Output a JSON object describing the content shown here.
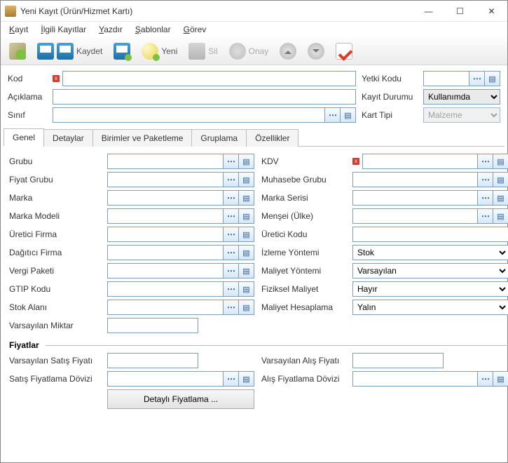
{
  "window": {
    "title": "Yeni Kayıt (Ürün/Hizmet Kartı)"
  },
  "menu": {
    "kayit": "Kayıt",
    "ilgili": "İlgili Kayıtlar",
    "yazdir": "Yazdır",
    "sablonlar": "Şablonlar",
    "gorev": "Görev"
  },
  "toolbar": {
    "kaydet": "Kaydet",
    "yeni": "Yeni",
    "sil": "Sil",
    "onay": "Onay"
  },
  "header": {
    "kod_label": "Kod",
    "kod_value": "",
    "aciklama_label": "Açıklama",
    "aciklama_value": "",
    "sinif_label": "Sınıf",
    "sinif_value": "",
    "yetki_label": "Yetki Kodu",
    "yetki_value": "",
    "durum_label": "Kayıt Durumu",
    "durum_value": "Kullanımda",
    "tipi_label": "Kart Tipi",
    "tipi_value": "Malzeme"
  },
  "tabs": {
    "genel": "Genel",
    "detaylar": "Detaylar",
    "birimler": "Birimler ve Paketleme",
    "gruplama": "Gruplama",
    "ozellikler": "Özellikler"
  },
  "fields": {
    "grubu": "Grubu",
    "grubu_v": "",
    "fiyat_grubu": "Fiyat Grubu",
    "fiyat_grubu_v": "",
    "marka": "Marka",
    "marka_v": "",
    "marka_modeli": "Marka Modeli",
    "marka_modeli_v": "",
    "uretici_firma": "Üretici Firma",
    "uretici_firma_v": "",
    "dagitici_firma": "Dağıtıcı Firma",
    "dagitici_firma_v": "",
    "vergi_paketi": "Vergi Paketi",
    "vergi_paketi_v": "",
    "gtip": "GTIP Kodu",
    "gtip_v": "",
    "stok_alani": "Stok Alanı",
    "stok_alani_v": "",
    "varsayilan_miktar": "Varsayılan Miktar",
    "varsayilan_miktar_v": "",
    "kdv": "KDV",
    "kdv_v": "",
    "muh_grubu": "Muhasebe Grubu",
    "muh_grubu_v": "",
    "marka_serisi": "Marka Serisi",
    "marka_serisi_v": "",
    "mensei": "Menşei (Ülke)",
    "mensei_v": "",
    "uretici_kodu": "Üretici Kodu",
    "uretici_kodu_v": "",
    "izleme": "İzleme Yöntemi",
    "izleme_v": "Stok",
    "maliyet_yontemi": "Maliyet Yöntemi",
    "maliyet_yontemi_v": "Varsayılan",
    "fiziksel_maliyet": "Fiziksel Maliyet",
    "fiziksel_maliyet_v": "Hayır",
    "maliyet_hesap": "Maliyet Hesaplama",
    "maliyet_hesap_v": "Yalın"
  },
  "fiyatlar": {
    "title": "Fiyatlar",
    "vars_satis": "Varsayılan Satış Fiyatı",
    "vars_satis_v": "",
    "satis_doviz": "Satış Fiyatlama Dövizi",
    "satis_doviz_v": "",
    "vars_alis": "Varsayılan Alış Fiyatı",
    "vars_alis_v": "",
    "alis_doviz": "Alış Fiyatlama Dövizi",
    "alis_doviz_v": "",
    "detayli": "Detaylı Fiyatlama ..."
  }
}
